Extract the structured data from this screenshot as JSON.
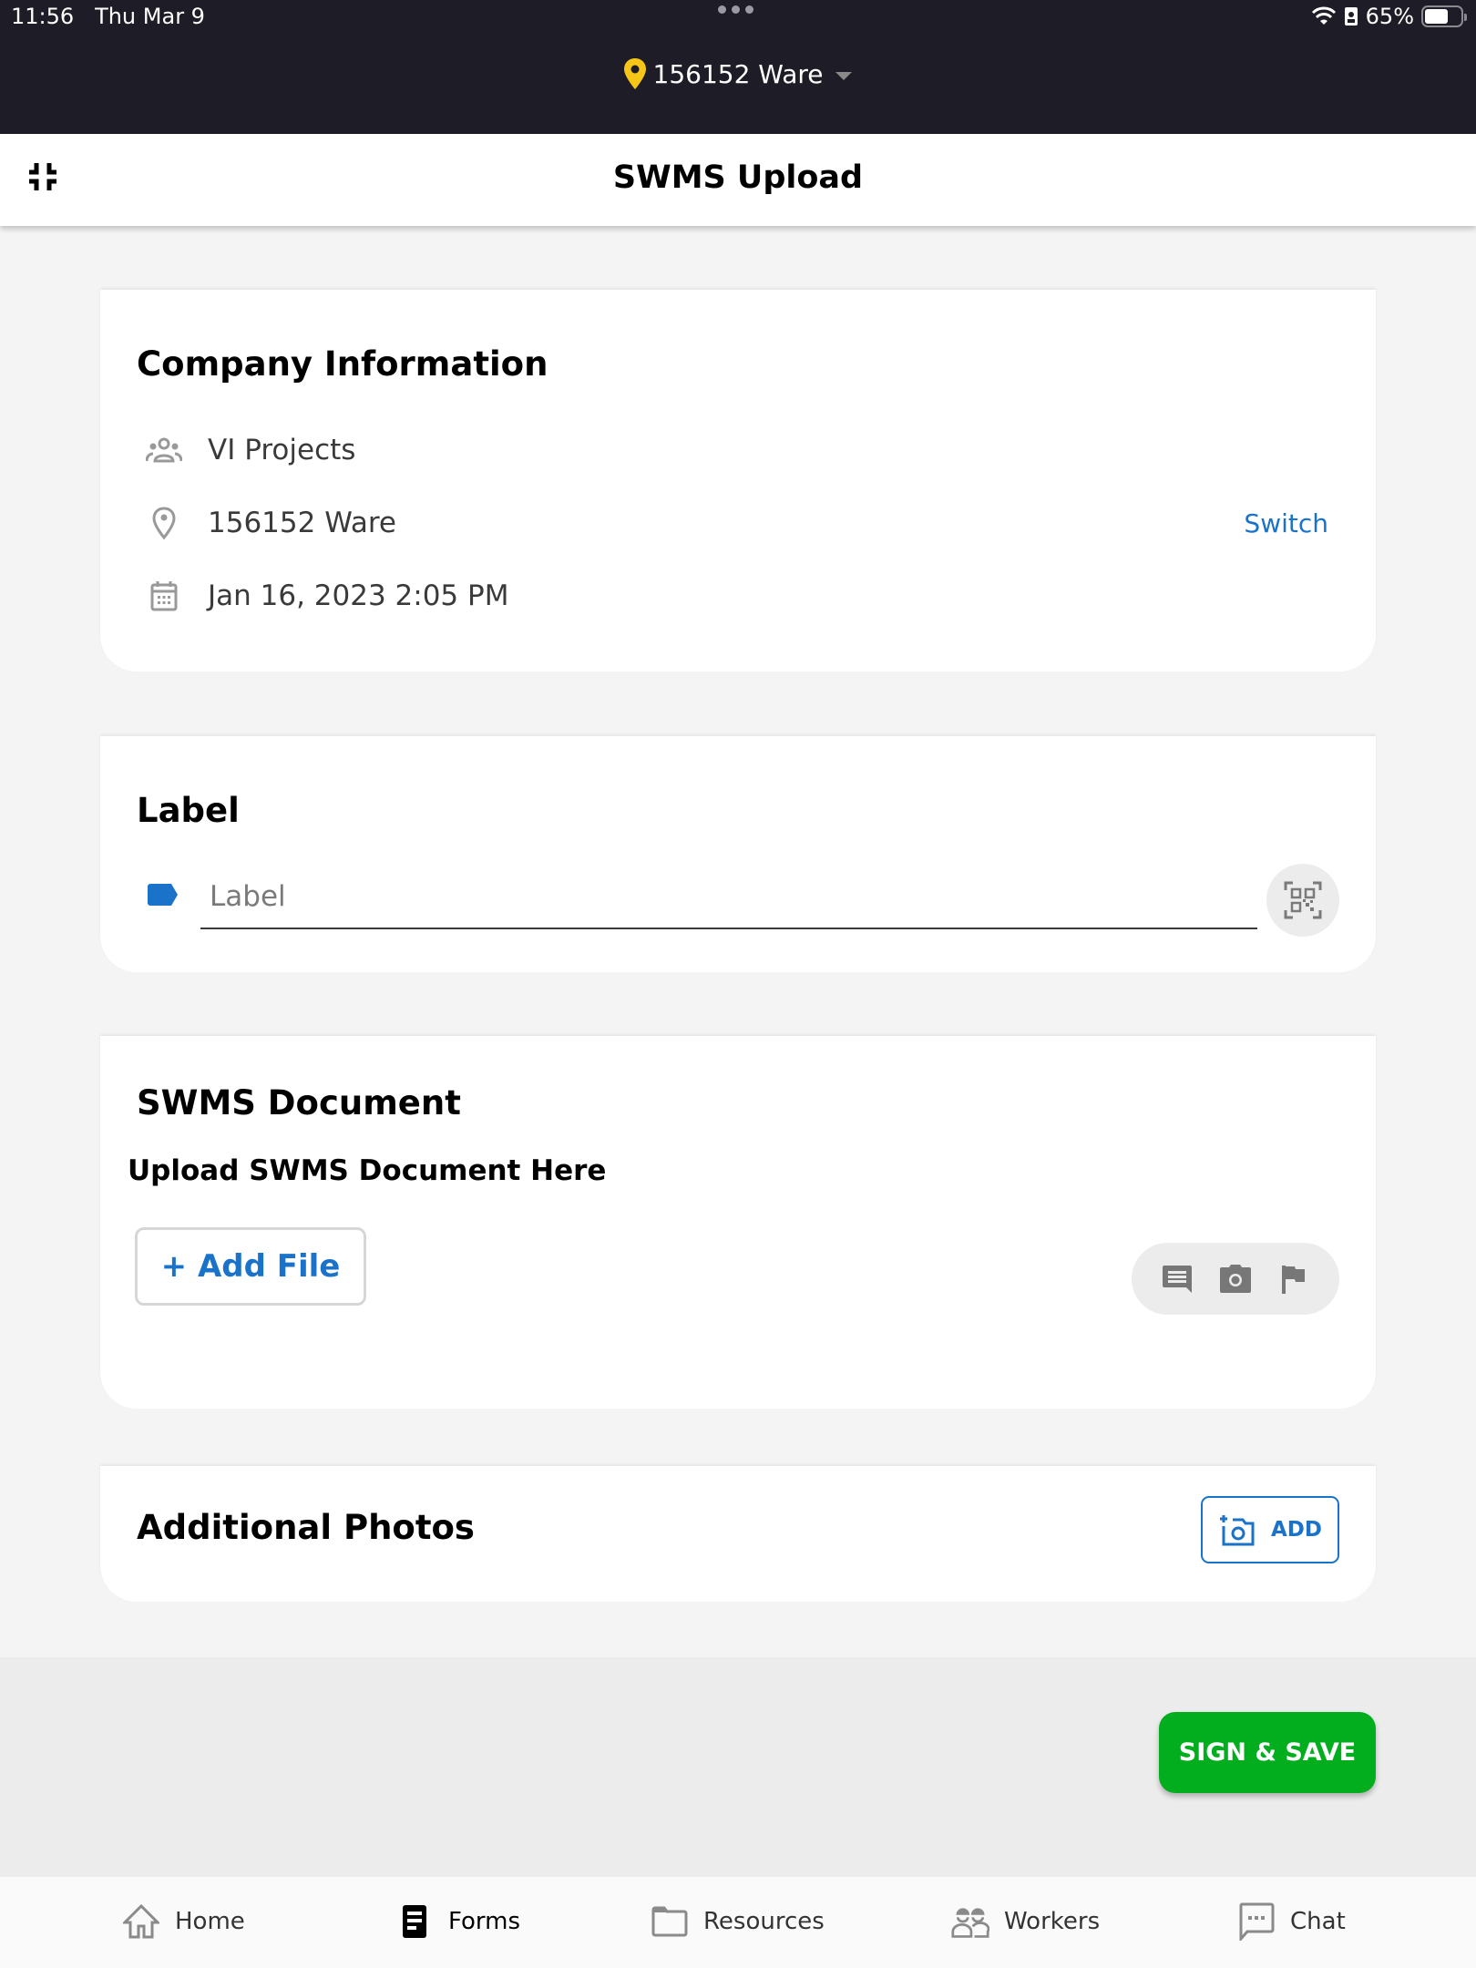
{
  "status_bar": {
    "time": "11:56",
    "date": "Thu Mar 9",
    "battery_percent_label": "65%",
    "battery_level": 0.65
  },
  "location_selector": {
    "value": "156152 Ware",
    "icon": "map-pin-icon"
  },
  "header": {
    "title": "SWMS Upload",
    "left_icon": "fullscreen-exit-icon"
  },
  "company_info": {
    "title": "Company Information",
    "company": "VI Projects",
    "location": "156152 Ware",
    "datetime": "Jan 16, 2023 2:05 PM",
    "switch_label": "Switch"
  },
  "label_section": {
    "title": "Label",
    "input_value": "",
    "input_placeholder": "Label",
    "qr_icon": "qr-scan-icon"
  },
  "swms_document": {
    "title": "SWMS Document",
    "upload_prompt": "Upload SWMS Document Here",
    "add_file_label": "+ Add File",
    "actions": [
      "comment-icon",
      "camera-icon",
      "flag-icon"
    ]
  },
  "additional_photos": {
    "title": "Additional Photos",
    "add_label": "ADD"
  },
  "footer": {
    "sign_save_label": "SIGN & SAVE"
  },
  "bottom_nav": {
    "items": [
      {
        "label": "Home",
        "icon": "home-icon",
        "active": false
      },
      {
        "label": "Forms",
        "icon": "forms-icon",
        "active": true
      },
      {
        "label": "Resources",
        "icon": "folder-icon",
        "active": false
      },
      {
        "label": "Workers",
        "icon": "workers-icon",
        "active": false
      },
      {
        "label": "Chat",
        "icon": "chat-icon",
        "active": false
      }
    ]
  },
  "colors": {
    "accent_blue": "#1a73c8",
    "success_green": "#02ae1e",
    "location_pin_yellow": "#f5c518",
    "top_bar": "#1e1d27"
  }
}
